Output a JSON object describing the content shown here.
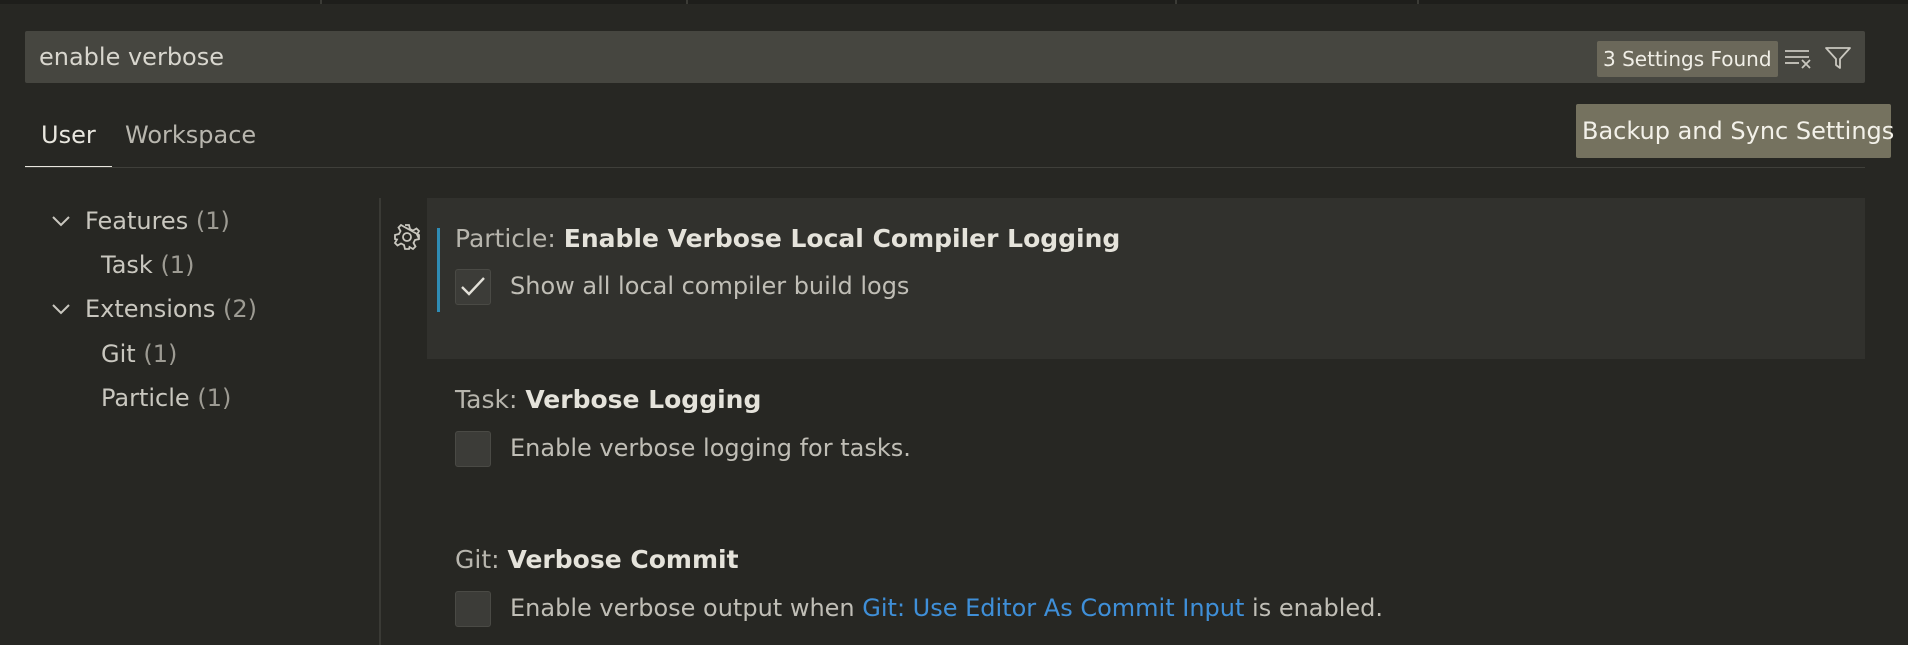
{
  "search": {
    "value": "enable verbose",
    "results_badge": "3 Settings Found",
    "clear_icon": "clear-filter-icon",
    "filter_icon": "filter-icon"
  },
  "tabs": [
    {
      "label": "User",
      "active": true
    },
    {
      "label": "Workspace",
      "active": false
    }
  ],
  "sync_button_label": "Backup and Sync Settings",
  "toc": [
    {
      "label": "Features",
      "count": "(1)",
      "expanded": true
    },
    {
      "label": "Task",
      "count": "(1)"
    },
    {
      "label": "Extensions",
      "count": "(2)",
      "expanded": true
    },
    {
      "label": "Git",
      "count": "(1)"
    },
    {
      "label": "Particle",
      "count": "(1)"
    }
  ],
  "settings": [
    {
      "category": "Particle: ",
      "key": "Enable Verbose Local Compiler Logging",
      "description": "Show all local compiler build logs",
      "checked": true
    },
    {
      "category": "Task: ",
      "key": "Verbose Logging",
      "description": "Enable verbose logging for tasks.",
      "checked": false
    },
    {
      "category": "Git: ",
      "key": "Verbose Commit",
      "description_before": "Enable verbose output when ",
      "description_link": "Git: Use Editor As Commit Input",
      "description_after": " is enabled.",
      "checked": false
    }
  ],
  "colors": {
    "background": "#272723",
    "accent": "#2f8cb5",
    "link": "#3f8fd8"
  }
}
